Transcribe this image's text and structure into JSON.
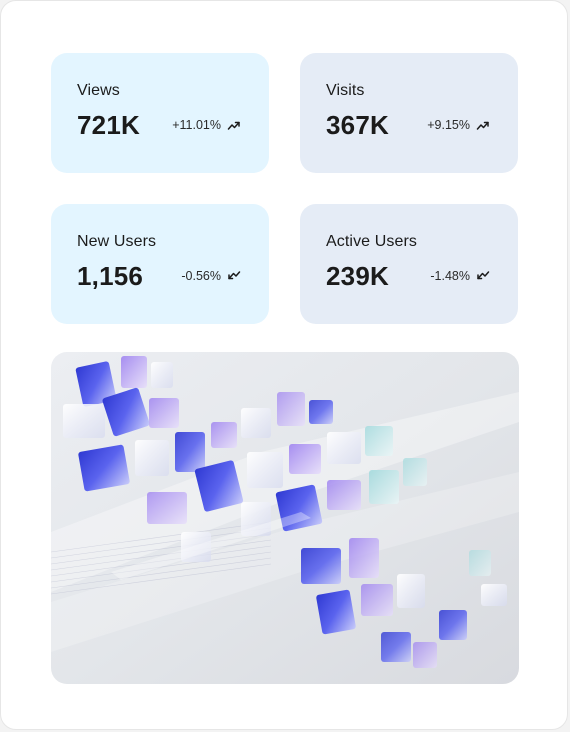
{
  "stats": [
    {
      "label": "Views",
      "value": "721K",
      "change": "+11.01%",
      "trend_icon": "trend-up-icon",
      "background": "#e3f5ff"
    },
    {
      "label": "Visits",
      "value": "367K",
      "change": "+9.15%",
      "trend_icon": "trend-up-icon",
      "background": "#e5ecf6"
    },
    {
      "label": "New Users",
      "value": "1,156",
      "change": "-0.56%",
      "trend_icon": "trend-down-icon",
      "background": "#e3f5ff"
    },
    {
      "label": "Active Users",
      "value": "239K",
      "change": "-1.48%",
      "trend_icon": "trend-down-icon",
      "background": "#e5ecf6"
    }
  ],
  "hero": {
    "description": "abstract-glass-cubes-illustration",
    "accent_colors": [
      "#3a3ad6",
      "#7d6ff0",
      "#a7d8e8",
      "#c9b6f2"
    ]
  }
}
